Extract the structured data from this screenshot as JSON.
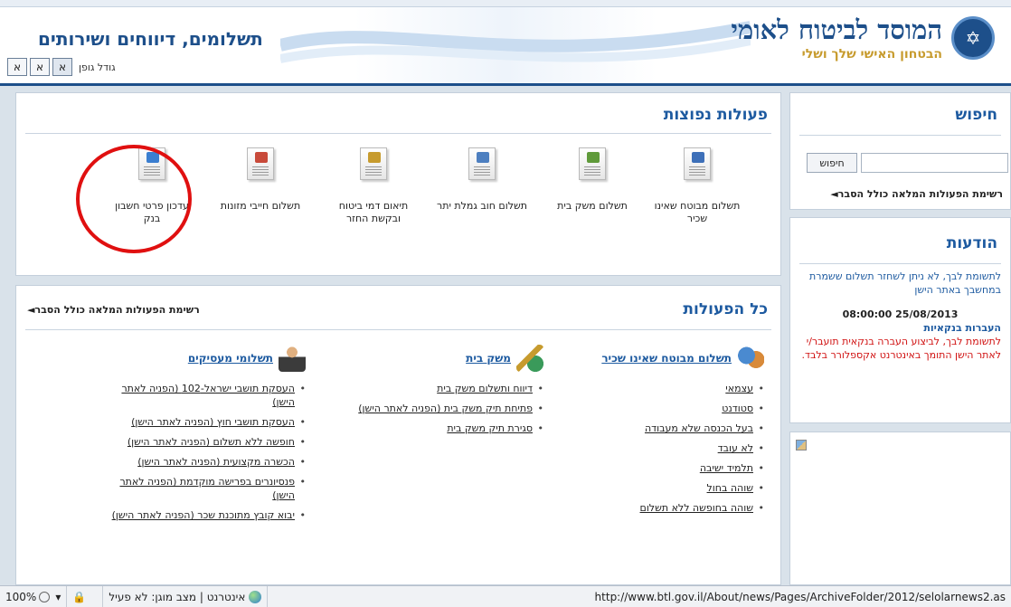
{
  "header": {
    "org_name": "המוסד לביטוח לאומי",
    "org_slogan": "הבטחון האישי שלך ושלי",
    "site_title": "תשלומים, דיווחים ושירותים",
    "font_size_label": "גודל גופן",
    "font_buttons": [
      "א",
      "א",
      "א"
    ]
  },
  "search": {
    "title": "חיפוש",
    "button_label": "חיפוש",
    "input_value": "",
    "full_list_link": "רשימת הפעולות המלאה כולל הסבר◄"
  },
  "popular": {
    "title": "פעולות נפוצות",
    "items": [
      {
        "label": "תשלום מבוטח שאינו שכיר",
        "icon": "document-people-icon"
      },
      {
        "label": "תשלום משק בית",
        "icon": "document-broom-icon"
      },
      {
        "label": "תשלום חוב גמלת יתר",
        "icon": "document-people-icon"
      },
      {
        "label": "תיאום דמי ביטוח ובקשת החזר",
        "icon": "document-transfer-icon"
      },
      {
        "label": "תשלום חייבי מזונות",
        "icon": "document-person-icon"
      },
      {
        "label": "עדכון פרטי חשבון בנק",
        "icon": "document-edit-icon"
      }
    ]
  },
  "all_actions": {
    "title": "כל הפעולות",
    "full_list_link": "רשימת הפעולות המלאה כולל הסבר◄",
    "columns": [
      {
        "title": "תשלום מבוטח שאינו שכיר",
        "icon": "people-icon",
        "items": [
          "עצמאי",
          "סטודנט",
          "בעל הכנסה שלא מעבודה",
          "לא עובד",
          "תלמיד ישיבה",
          "שוהה בחול",
          "שוהה בחופשה ללא תשלום"
        ]
      },
      {
        "title": "משק בית",
        "icon": "cleaning-tools-icon",
        "items": [
          "דיווח ותשלום משק בית",
          "פתיחת תיק משק בית (הפניה לאתר הישן)",
          "סגירת תיק משק בית"
        ]
      },
      {
        "title": "תשלומי מעסיקים",
        "icon": "employer-icon",
        "items": [
          "העסקת תושבי ישראל-102 (הפניה לאתר הישן)",
          "העסקת תושבי חוץ (הפניה לאתר הישן)",
          "חופשה ללא תשלום (הפניה לאתר הישן)",
          "הכשרה מקצועית (הפניה לאתר הישן)",
          "פנסיונרים בפרישה מוקדמת (הפניה לאתר הישן)",
          "יבוא קובץ מתוכנת שכר (הפניה לאתר הישן)"
        ]
      }
    ]
  },
  "news": {
    "title": "הודעות",
    "item1_text": "לתשומת לבך, לא ניתן לשחזר תשלום ששמרת במחשבך באתר הישן",
    "item2_date": "25/08/2013 08:00:00",
    "item2_head": "העברות בנקאיות",
    "item2_text": "לתשומת לבך, לביצוע העברה בנקאית תועבר/י לאתר הישן התומך באינטרנט אקספלורר בלבד."
  },
  "statusbar": {
    "zoom": "100%",
    "zone": "אינטרנט | מצב מוגן: לא פעיל",
    "url": "http://www.btl.gov.il/About/news/Pages/ArchiveFolder/2012/selolarnews2.as"
  },
  "colors": {
    "brand_blue": "#1d4f8a",
    "link_blue": "#1d5aa0",
    "alert_red": "#d01010",
    "highlight_circle": "#e01010"
  }
}
